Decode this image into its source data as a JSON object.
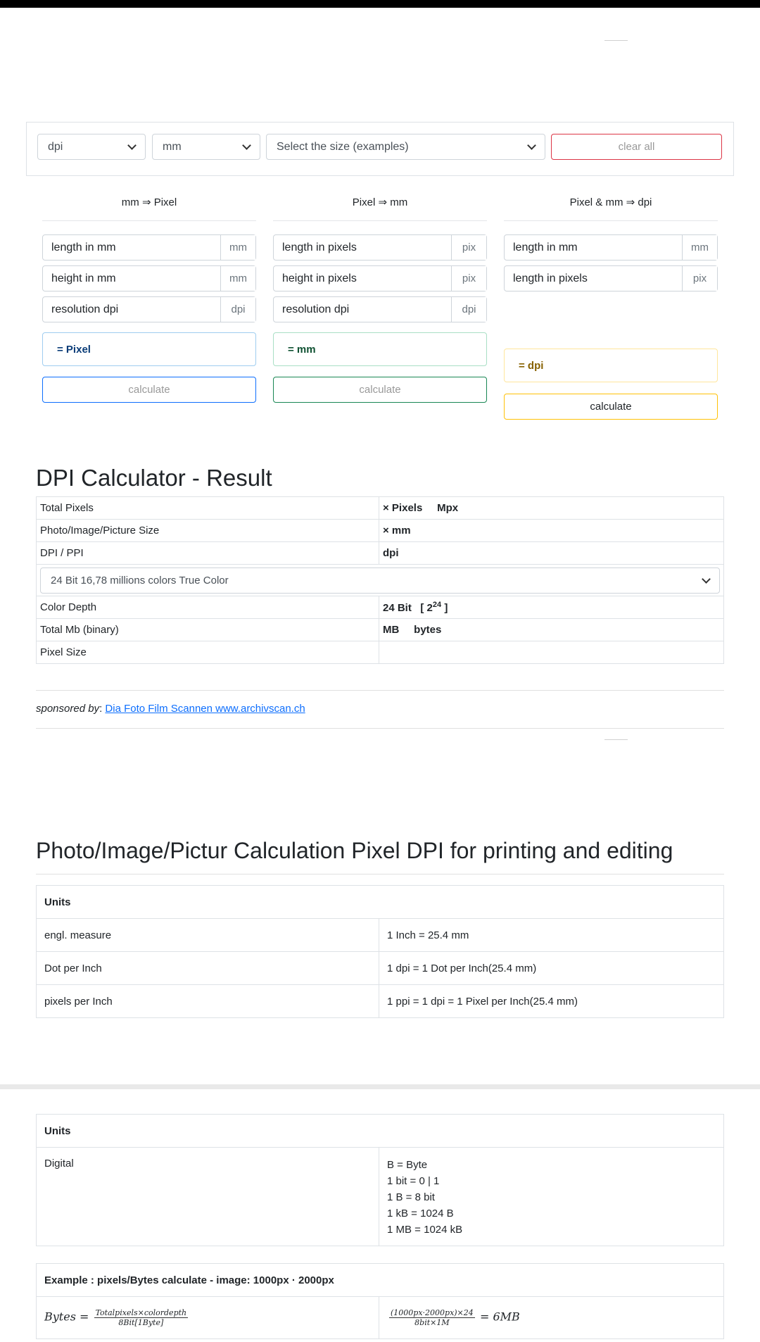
{
  "toolbar": {
    "unit1": "dpi",
    "unit2": "mm",
    "size_select": "Select the size (examples)",
    "clear_all": "clear all"
  },
  "columns": [
    {
      "title": "mm ⇒ Pixel",
      "fields": [
        {
          "placeholder": "length in mm",
          "unit": "mm"
        },
        {
          "placeholder": "height in mm",
          "unit": "mm"
        },
        {
          "placeholder": "resolution dpi",
          "unit": "dpi"
        }
      ],
      "result": "= Pixel",
      "button": "calculate"
    },
    {
      "title": "Pixel ⇒ mm",
      "fields": [
        {
          "placeholder": "length in pixels",
          "unit": "pix"
        },
        {
          "placeholder": "height in pixels",
          "unit": "pix"
        },
        {
          "placeholder": "resolution dpi",
          "unit": "dpi"
        }
      ],
      "result": "= mm",
      "button": "calculate"
    },
    {
      "title": "Pixel & mm ⇒ dpi",
      "fields": [
        {
          "placeholder": "length in mm",
          "unit": "mm"
        },
        {
          "placeholder": "length in pixels",
          "unit": "pix"
        }
      ],
      "result": "= dpi",
      "button": "calculate"
    }
  ],
  "result": {
    "title": "DPI Calculator - Result",
    "rows": {
      "total_pixels": {
        "label": "Total Pixels",
        "value_a": "× Pixels",
        "value_b": "Mpx"
      },
      "photo_size": {
        "label": "Photo/Image/Picture Size",
        "value": "× mm"
      },
      "dpi": {
        "label": "DPI / PPI",
        "value": "dpi"
      },
      "color_select": "24 Bit 16,78 millions colors True Color",
      "color_depth": {
        "label": "Color Depth",
        "value": "24 Bit",
        "base": "[ 2",
        "exp": "24",
        "close": "]"
      },
      "total_mb": {
        "label": "Total Mb (binary)",
        "value_a": "MB",
        "value_b": "bytes"
      },
      "pixel_size": {
        "label": "Pixel Size",
        "value": ""
      }
    }
  },
  "sponsor": {
    "prefix": "sponsored by",
    "colon": ":",
    "link": "Dia Foto Film Scannen www.archivscan.ch"
  },
  "section": {
    "title": "Photo/Image/Pictur Calculation Pixel DPI for printing and editing"
  },
  "units_table": {
    "header": "Units",
    "rows": [
      {
        "name": "engl. measure",
        "value": "1 Inch = 25.4 mm"
      },
      {
        "name": "Dot per Inch",
        "value": "1 dpi = 1 Dot per Inch(25.4 mm)"
      },
      {
        "name": "pixels per Inch",
        "value": "1 ppi = 1 dpi = 1 Pixel per Inch(25.4 mm)"
      }
    ]
  },
  "digital_table": {
    "header": "Units",
    "name": "Digital",
    "lines": [
      "B = Byte",
      "1 bit = 0 | 1",
      "1 B = 8 bit",
      "1 kB = 1024 B",
      "1 MB = 1024 kB"
    ]
  },
  "example": {
    "header": "Example : pixels/Bytes calculate - image: 1000px · 2000px",
    "formula_lhs": "Bytes =",
    "formula_num": "Totalpixels×colordepth",
    "formula_den": "8Bit[1Byte]",
    "calc_num": "(1000px·2000px)×24",
    "calc_den": "8bit×1M",
    "calc_result": "= 6MB"
  }
}
